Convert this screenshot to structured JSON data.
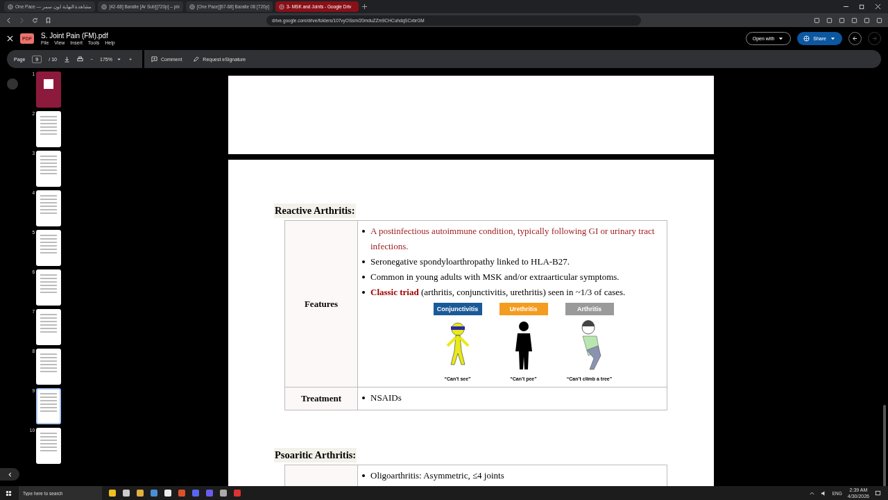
{
  "browser": {
    "tabs": [
      {
        "title": "One Pace — مشاهدة النهاية لون سمر",
        "selected": false
      },
      {
        "title": "[42-68] Baratie [Ar Sub][720p] – pix",
        "selected": false
      },
      {
        "title": "[One Pace][67-68] Baratie 08 [720p]",
        "selected": false
      },
      {
        "title": "3- MSK and Joints - Google Driv",
        "selected": true
      }
    ],
    "url": "drive.google.com/drive/folders/107vyOSsm/20mduZZm9CHCuhdqSCxbrGM"
  },
  "viewer": {
    "file_name": "S. Joint Pain (FM).pdf",
    "file_badge": "PDF",
    "menus": [
      "File",
      "View",
      "Insert",
      "Tools",
      "Help"
    ],
    "open_with": "Open with",
    "share": "Share",
    "toolbar": {
      "page_label": "Page",
      "page_current": "9",
      "page_total": "/ 10",
      "zoom": "175%",
      "zoom_out": "−",
      "zoom_in": "+",
      "actions": [
        "Comment",
        "Request eSignature"
      ]
    }
  },
  "thumbnails": [
    {
      "number": "1",
      "kind": "cover",
      "selected": false
    },
    {
      "number": "2",
      "kind": "text",
      "selected": false
    },
    {
      "number": "3",
      "kind": "text",
      "selected": false
    },
    {
      "number": "4",
      "kind": "text",
      "selected": false
    },
    {
      "number": "5",
      "kind": "text",
      "selected": false
    },
    {
      "number": "6",
      "kind": "text",
      "selected": false
    },
    {
      "number": "7",
      "kind": "text",
      "selected": false
    },
    {
      "number": "8",
      "kind": "text",
      "selected": false
    },
    {
      "number": "9",
      "kind": "text",
      "selected": true
    },
    {
      "number": "10",
      "kind": "text",
      "selected": false
    }
  ],
  "document": {
    "sections": [
      {
        "heading": "Reactive Arthritis:",
        "rows": [
          {
            "label": "Features",
            "bullets": [
              {
                "text": "A postinfectious autoimmune condition, typically following GI or urinary tract infections.",
                "emphasis": true
              },
              {
                "text": "Seronegative spondyloarthropathy linked to HLA-B27.",
                "emphasis": false
              },
              {
                "text": "Common in young adults with MSK and/or extraarticular symptoms.",
                "emphasis": false
              },
              {
                "text": "**Classic triad** (arthritis, conjunctivitis, urethritis) seen in ~1/3 of cases.",
                "emphasis": false
              }
            ],
            "figures": [
              {
                "tag": "Conjunctivitis",
                "color": "#1b5a98",
                "kind": "blindfold",
                "caption": "“Can’t see”"
              },
              {
                "tag": "Urethritis",
                "color": "#f39c1f",
                "kind": "silhouette",
                "caption": "“Can’t pee”"
              },
              {
                "tag": "Arthritis",
                "color": "#9a9a9a",
                "kind": "knee",
                "caption": "“Can’t climb a tree”"
              }
            ]
          },
          {
            "label": "Treatment",
            "bullets": [
              {
                "text": "NSAIDs",
                "emphasis": false
              }
            ]
          }
        ]
      },
      {
        "heading": "Psoaritic Arthritis:",
        "rows": [
          {
            "label": "",
            "bullets": [
              {
                "text": "Oligoarthritis: Asymmetric, ≤4 joints",
                "emphasis": false
              }
            ]
          }
        ]
      }
    ]
  },
  "taskbar": {
    "search_placeholder": "Type here to search",
    "language": "ENG",
    "time": "2:39 AM",
    "date": "4/30/2026"
  }
}
